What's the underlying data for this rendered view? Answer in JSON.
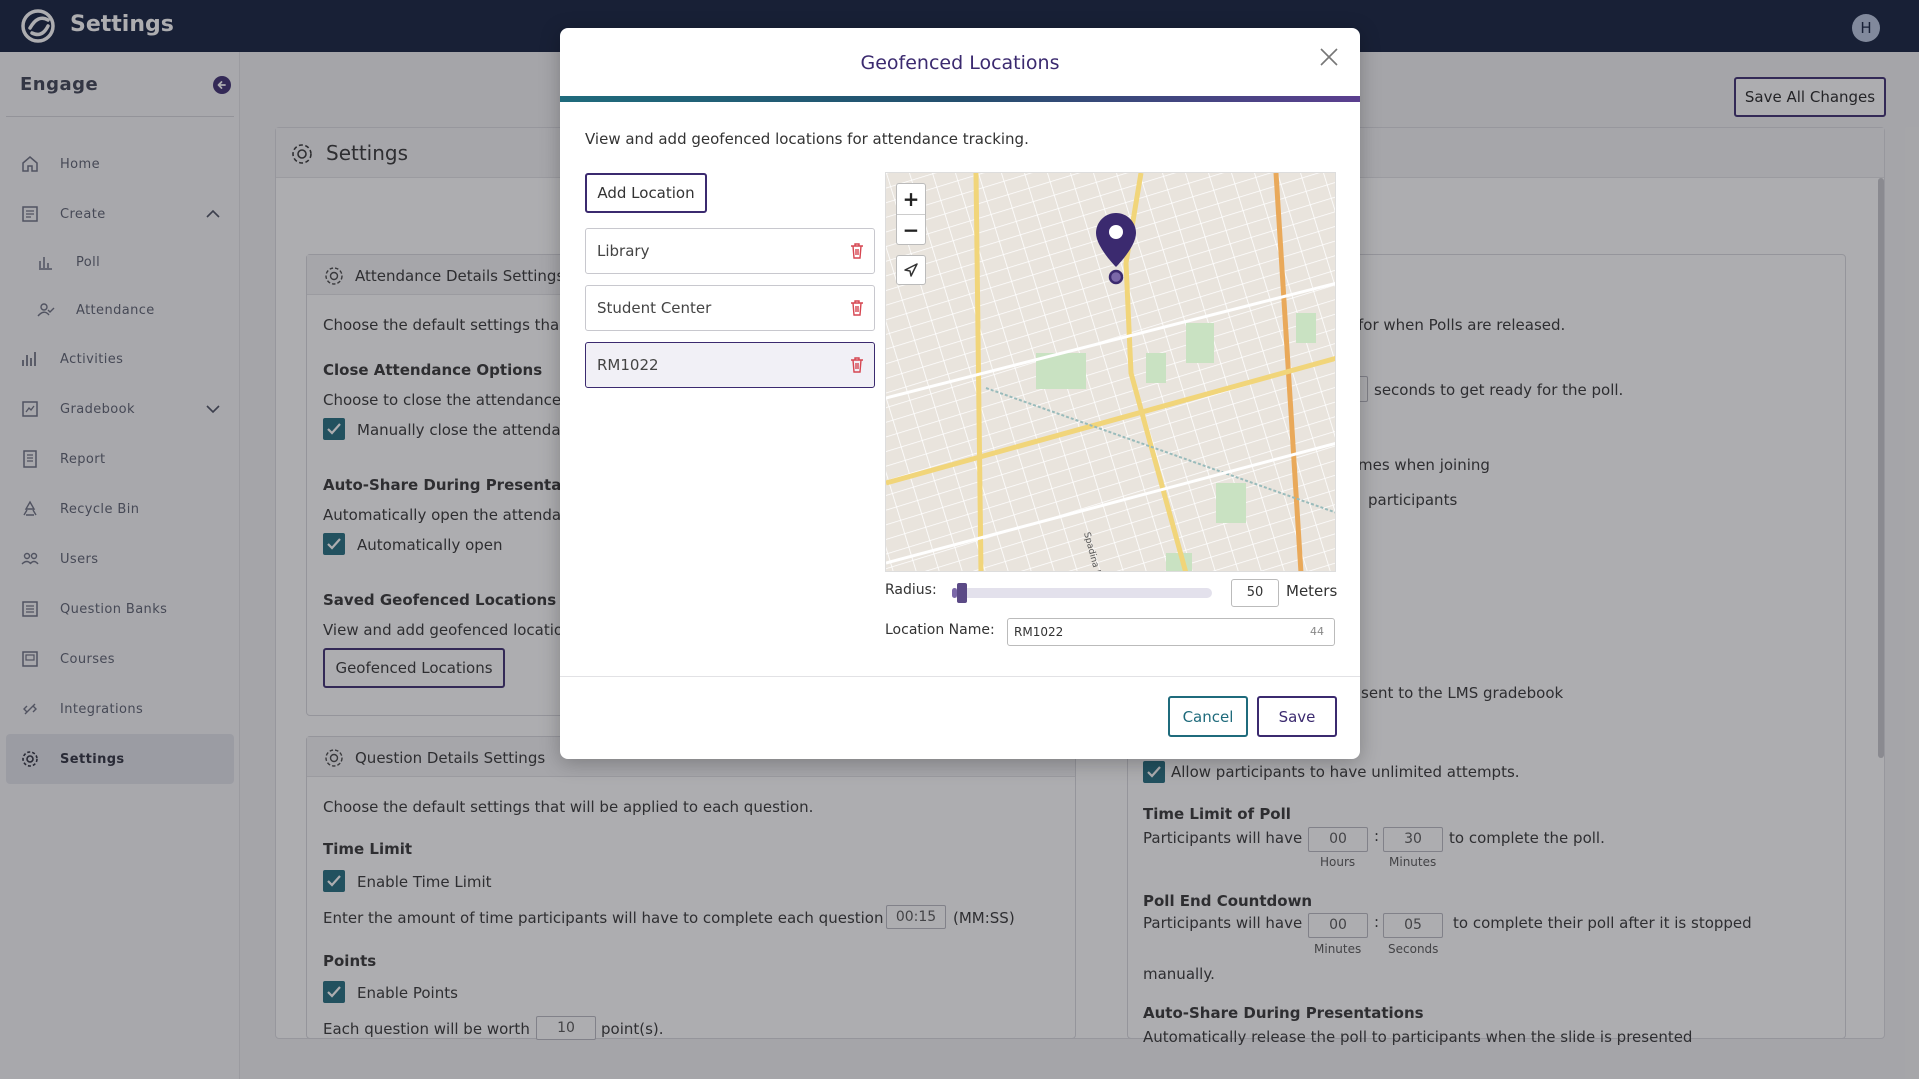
{
  "app": {
    "title": "Settings",
    "avatar_letter": "H"
  },
  "sidebar": {
    "brand": "Engage",
    "items": [
      {
        "label": "Home",
        "icon": "home-icon"
      },
      {
        "label": "Create",
        "icon": "create-icon",
        "expanded": true
      },
      {
        "label": "Poll",
        "icon": "poll-icon",
        "sub": true
      },
      {
        "label": "Attendance",
        "icon": "attendance-icon",
        "sub": true
      },
      {
        "label": "Activities",
        "icon": "activities-icon"
      },
      {
        "label": "Gradebook",
        "icon": "gradebook-icon",
        "expanded": false
      },
      {
        "label": "Report",
        "icon": "report-icon"
      },
      {
        "label": "Recycle Bin",
        "icon": "recycle-icon"
      },
      {
        "label": "Users",
        "icon": "users-icon"
      },
      {
        "label": "Question Banks",
        "icon": "question-banks-icon"
      },
      {
        "label": "Courses",
        "icon": "courses-icon"
      },
      {
        "label": "Integrations",
        "icon": "integrations-icon"
      },
      {
        "label": "Settings",
        "icon": "settings-icon",
        "active": true
      }
    ]
  },
  "main": {
    "save_all_label": "Save All Changes",
    "settings_title": "Settings",
    "attendance": {
      "title": "Attendance Details Settings",
      "intro": "Choose the default settings tha",
      "close_heading": "Close Attendance Options",
      "close_desc": "Choose to close the attendance",
      "close_cb": "Manually close the attenda",
      "autoshare_heading": "Auto-Share During Presentati",
      "autoshare_desc": "Automatically open the attenda",
      "autoshare_cb": "Automatically open",
      "geofence_heading": "Saved Geofenced Locations",
      "geofence_desc": "View and add geofenced locatio",
      "geofence_button": "Geofenced Locations"
    },
    "question": {
      "title": "Question Details Settings",
      "intro": "Choose the default settings that will be applied to each question.",
      "time_heading": "Time Limit",
      "time_cb": "Enable Time Limit",
      "time_desc": "Enter the amount of time participants will have to complete each question",
      "time_value": "00:15",
      "time_unit": "(MM:SS)",
      "points_heading": "Points",
      "points_cb": "Enable Points",
      "points_desc": "Each question will be worth",
      "points_value": "10",
      "points_unit": "point(s)."
    },
    "poll": {
      "release_text": "for when Polls are released.",
      "ready_text": "seconds to get ready for the poll.",
      "names_text": "mes when joining",
      "participants_text": "participants",
      "lms_text": "sent to the LMS gradebook",
      "unlimited_cb": "Allow participants to have unlimited attempts.",
      "time_limit_heading": "Time Limit of Poll",
      "time_limit_prefix": "Participants will have",
      "time_limit_hours": "00",
      "time_limit_minutes": "30",
      "time_limit_suffix": "to complete the poll.",
      "hours_label": "Hours",
      "minutes_label": "Minutes",
      "countdown_heading": "Poll End Countdown",
      "countdown_prefix": "Participants will have",
      "countdown_minutes": "00",
      "countdown_seconds": "05",
      "countdown_suffix": "to complete their poll after it is stopped",
      "countdown_suffix2": "manually.",
      "countdown_min_label": "Minutes",
      "countdown_sec_label": "Seconds",
      "autoshare_heading": "Auto-Share During Presentations",
      "autoshare_desc": "Automatically release the poll to participants when the slide is presented"
    },
    "separator": ":"
  },
  "modal": {
    "title": "Geofenced Locations",
    "description": "View and add geofenced locations for attendance tracking.",
    "add_button": "Add Location",
    "locations": [
      {
        "name": "Library"
      },
      {
        "name": "Student Center"
      },
      {
        "name": "RM1022",
        "selected": true
      }
    ],
    "map": {
      "zoom_in": "+",
      "zoom_out": "−",
      "street_label": "Spadina Road"
    },
    "radius_label": "Radius:",
    "radius_value": "50",
    "radius_fraction": 0.02,
    "radius_unit": "Meters",
    "location_name_label": "Location Name:",
    "location_name_value": "RM1022",
    "location_name_remaining": "44",
    "cancel_label": "Cancel",
    "save_label": "Save"
  },
  "colors": {
    "topbar": "#0f1c3a",
    "accent": "#3b2a6f",
    "teal": "#1f6b7c",
    "danger": "#d64550"
  }
}
